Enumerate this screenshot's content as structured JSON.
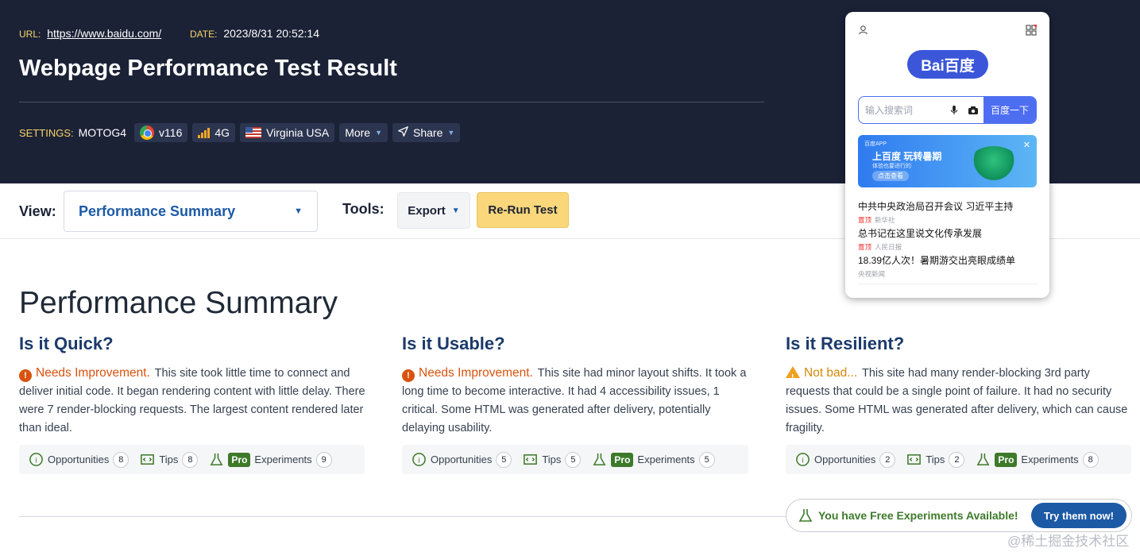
{
  "header": {
    "url_label": "URL:",
    "url": "https://www.baidu.com/",
    "date_label": "DATE:",
    "date": "2023/8/31 20:52:14",
    "title": "Webpage Performance Test Result",
    "settings_label": "SETTINGS:",
    "device": "MOTOG4",
    "browser": "v116",
    "connection": "4G",
    "location": "Virginia USA",
    "more": "More",
    "share": "Share"
  },
  "toolbar": {
    "view_label": "View:",
    "view_value": "Performance Summary",
    "tools_label": "Tools:",
    "export": "Export",
    "rerun": "Re-Run Test"
  },
  "summary": {
    "title": "Performance Summary",
    "columns": [
      {
        "heading": "Is it Quick?",
        "status": "Needs Improvement.",
        "status_level": "needs-improvement",
        "text": "This site took little time to connect and deliver initial code. It began rendering content with little delay. There were 7 render-blocking requests. The largest content rendered later than ideal.",
        "opportunities_label": "Opportunities",
        "opportunities": "8",
        "tips_label": "Tips",
        "tips": "8",
        "pro_label": "Pro",
        "experiments_label": "Experiments",
        "experiments": "9"
      },
      {
        "heading": "Is it Usable?",
        "status": "Needs Improvement.",
        "status_level": "needs-improvement",
        "text": "This site had minor layout shifts. It took a long time to become interactive. It had 4 accessibility issues, 1 critical. Some HTML was generated after delivery, potentially delaying usability.",
        "opportunities_label": "Opportunities",
        "opportunities": "5",
        "tips_label": "Tips",
        "tips": "5",
        "pro_label": "Pro",
        "experiments_label": "Experiments",
        "experiments": "5"
      },
      {
        "heading": "Is it Resilient?",
        "status": "Not bad...",
        "status_level": "warning",
        "text": "This site had many render-blocking 3rd party requests that could be a single point of failure. It had no security issues. Some HTML was generated after delivery, which can cause fragility.",
        "opportunities_label": "Opportunities",
        "opportunities": "2",
        "tips_label": "Tips",
        "tips": "2",
        "pro_label": "Pro",
        "experiments_label": "Experiments",
        "experiments": "8"
      }
    ]
  },
  "free_banner": {
    "text": "You have Free Experiments Available!",
    "button": "Try them now!"
  },
  "watermark": "@稀土掘金技术社区",
  "phone": {
    "logo": "Bai百度",
    "search_placeholder": "输入搜索词",
    "search_button": "百度一下",
    "banner_app": "百度APP",
    "banner_title": "上百度 玩转暑期",
    "banner_sub": "体验也要进行的",
    "banner_btn": "点击查看",
    "news": [
      {
        "title": "中共中央政治局召开会议 习近平主持",
        "tag": "置顶",
        "source": "新华社"
      },
      {
        "title": "总书记在这里说文化传承发展",
        "tag": "置顶",
        "source": "人民日报"
      },
      {
        "title": "18.39亿人次！暑期游交出亮眼成绩单",
        "tag": "",
        "source": "央视新闻"
      }
    ]
  },
  "colors": {
    "header_bg": "#1b2236",
    "accent": "#1c5aa6",
    "warn": "#d9530f",
    "pro": "#3d7a2a",
    "rerun": "#f9d77a"
  }
}
